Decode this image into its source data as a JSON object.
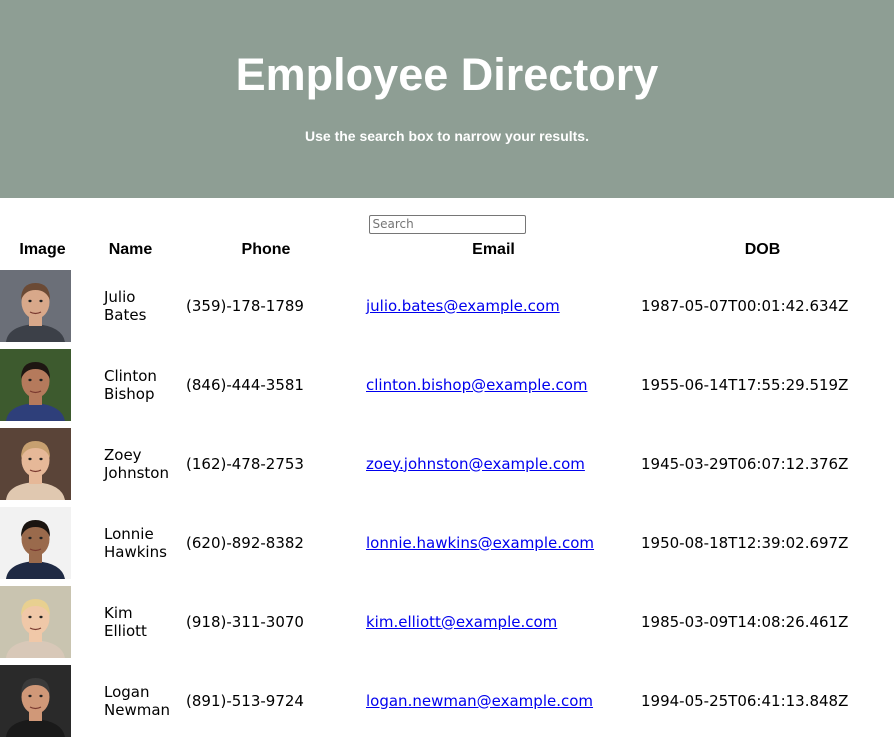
{
  "header": {
    "title": "Employee Directory",
    "subtitle": "Use the search box to narrow your results."
  },
  "search": {
    "placeholder": "Search",
    "value": ""
  },
  "table": {
    "columns": [
      "Image",
      "Name",
      "Phone",
      "Email",
      "DOB"
    ],
    "rows": [
      {
        "name": "Julio Bates",
        "phone": "(359)-178-1789",
        "email": "julio.bates@example.com",
        "dob": "1987-05-07T00:01:42.634Z",
        "avatar": {
          "bg": "#6b6f78",
          "skin": "#d8a88a",
          "hair": "#6b4a35",
          "shirt": "#3c4048"
        }
      },
      {
        "name": "Clinton Bishop",
        "phone": "(846)-444-3581",
        "email": "clinton.bishop@example.com",
        "dob": "1955-06-14T17:55:29.519Z",
        "avatar": {
          "bg": "#3d5a2e",
          "skin": "#b57a5c",
          "hair": "#1e1612",
          "shirt": "#2e3f7a"
        }
      },
      {
        "name": "Zoey Johnston",
        "phone": "(162)-478-2753",
        "email": "zoey.johnston@example.com",
        "dob": "1945-03-29T06:07:12.376Z",
        "avatar": {
          "bg": "#5a4438",
          "skin": "#e6b898",
          "hair": "#c7a070",
          "shirt": "#e0c8b0"
        }
      },
      {
        "name": "Lonnie Hawkins",
        "phone": "(620)-892-8382",
        "email": "lonnie.hawkins@example.com",
        "dob": "1950-08-18T12:39:02.697Z",
        "avatar": {
          "bg": "#f2f2f2",
          "skin": "#9a6a4c",
          "hair": "#1a1410",
          "shirt": "#1f2a44"
        }
      },
      {
        "name": "Kim Elliott",
        "phone": "(918)-311-3070",
        "email": "kim.elliott@example.com",
        "dob": "1985-03-09T14:08:26.461Z",
        "avatar": {
          "bg": "#c9c4b0",
          "skin": "#f0c8a8",
          "hair": "#e8d090",
          "shirt": "#d8c8b8"
        }
      },
      {
        "name": "Logan Newman",
        "phone": "(891)-513-9724",
        "email": "logan.newman@example.com",
        "dob": "1994-05-25T06:41:13.848Z",
        "avatar": {
          "bg": "#2a2a2a",
          "skin": "#d09878",
          "hair": "#3a3a3a",
          "shirt": "#1a1a1a"
        }
      }
    ]
  }
}
